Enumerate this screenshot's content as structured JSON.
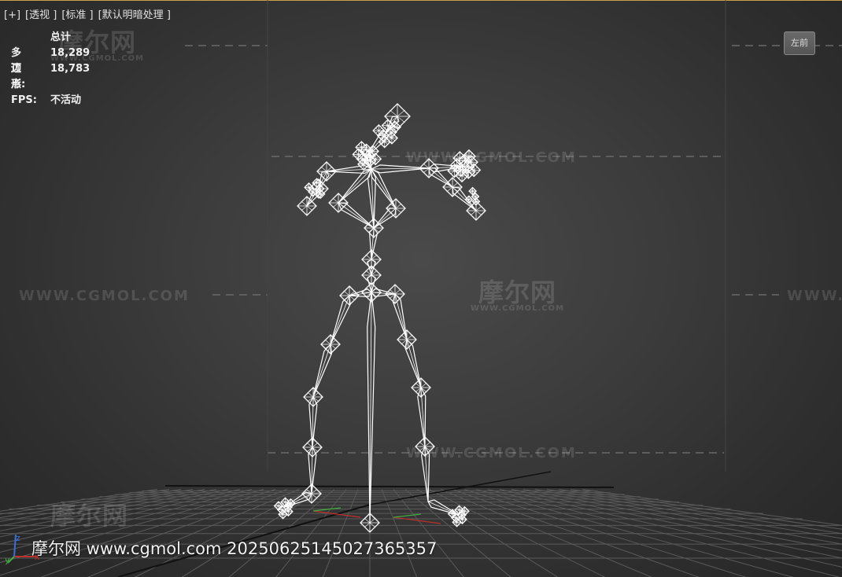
{
  "viewport": {
    "labels": [
      "[+]",
      "[透视 ]",
      "[标准 ]",
      "[默认明暗处理 ]"
    ]
  },
  "stats": {
    "header": "总计",
    "polygons_label": "多边形:",
    "polygons_value": "18,289",
    "vertices_label": "顶点:",
    "vertices_value": "18,783",
    "fps_label": "FPS:",
    "fps_value": "不活动"
  },
  "viewcube": {
    "label": "左前",
    "icon": "viewcube-icon"
  },
  "watermark": {
    "logo_cn": "摩尔网",
    "logo_en": "WWW.CGMOL.COM",
    "url": "WWW.CGMOL.COM"
  },
  "credit": "摩尔网 www.cgmol.com 20250625145027365357",
  "axis": {
    "x": "x",
    "y": "y",
    "z": "z"
  },
  "colors": {
    "background": "#3a3a3a",
    "wire": "#ffffff",
    "grid": "#5a5a5a",
    "axis_x": "#c0302a",
    "axis_y": "#3fae3f",
    "axis_z": "#3a6fd8"
  }
}
